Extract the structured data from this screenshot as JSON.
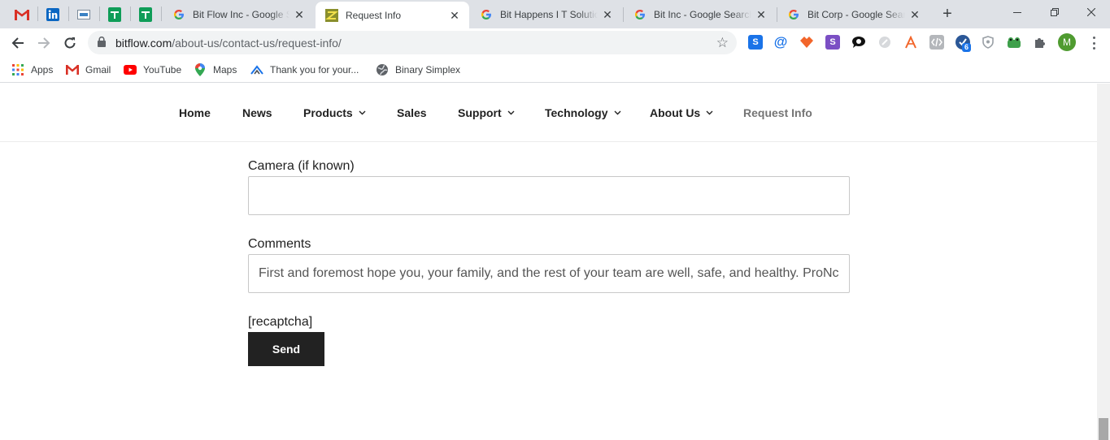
{
  "browser": {
    "tabs": [
      {
        "title": "Bit Flow Inc - Google Search",
        "active": false
      },
      {
        "title": "Request Info",
        "active": true
      },
      {
        "title": "Bit Happens I T Solutions - Google Search",
        "active": false
      },
      {
        "title": "Bit Inc - Google Search",
        "active": false
      },
      {
        "title": "Bit Corp - Google Search",
        "active": false
      }
    ],
    "address": {
      "domain": "bitflow.com",
      "path": "/about-us/contact-us/request-info/"
    },
    "extension_badge": "6",
    "profile_initial": "M",
    "bookmarks": [
      {
        "label": "Apps"
      },
      {
        "label": "Gmail"
      },
      {
        "label": "YouTube"
      },
      {
        "label": "Maps"
      },
      {
        "label": "Thank you for your..."
      },
      {
        "label": "Binary Simplex"
      }
    ]
  },
  "site_nav": {
    "items": [
      {
        "label": "Home"
      },
      {
        "label": "News"
      },
      {
        "label": "Products"
      },
      {
        "label": "Sales"
      },
      {
        "label": "Support"
      },
      {
        "label": "Technology"
      },
      {
        "label": "About Us"
      },
      {
        "label": "Request Info"
      }
    ]
  },
  "form": {
    "camera_label": "Camera (if known)",
    "camera_value": "",
    "comments_label": "Comments",
    "comments_value": "First and foremost hope you, your family, and the rest of your team are well, safe, and healthy.  ProNc",
    "recaptcha_placeholder": "[recaptcha]",
    "send_label": "Send"
  },
  "colors": {
    "tab_strip": "#dee1e6",
    "send_button": "#222222",
    "nav_current": "#757575"
  }
}
